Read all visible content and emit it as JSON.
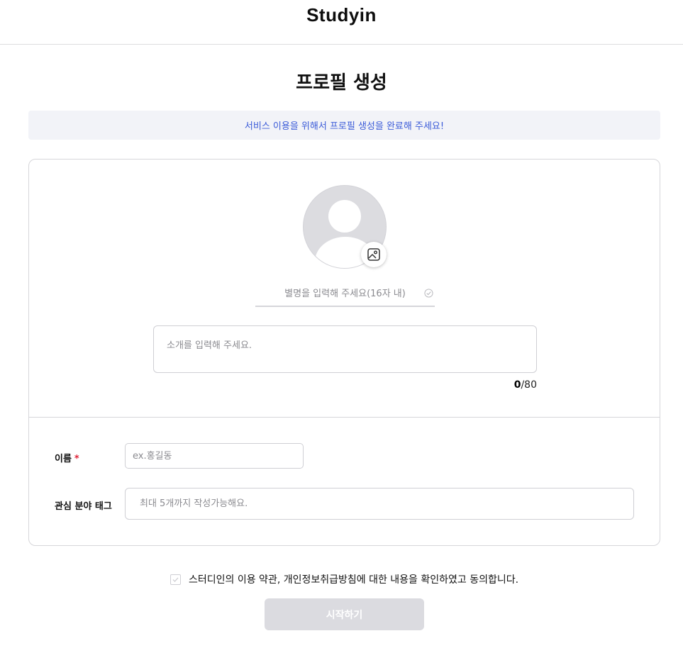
{
  "header": {
    "logo_text": "Studyin"
  },
  "page": {
    "title": "프로필 생성",
    "notice": "서비스 이용을 위해서 프로필 생성을 완료해 주세요!"
  },
  "profile": {
    "avatar_icon": "user-silhouette-icon",
    "photo_button_icon": "image-icon",
    "nickname_placeholder": "별명을 입력해 주세요(16자 내)",
    "nickname_value": "",
    "nickname_check_icon": "check-circle-icon",
    "intro_placeholder": "소개를 입력해 주세요.",
    "intro_value": "",
    "intro_count": "0",
    "intro_max": "/80"
  },
  "fields": {
    "name_label": "이름",
    "required_mark": "*",
    "name_placeholder": "ex.홍길동",
    "name_value": "",
    "tags_label": "관심 분야 태그",
    "tags_placeholder": "최대 5개까지 작성가능해요.",
    "tags_value": ""
  },
  "agreement": {
    "checked": false,
    "text": "스터디인의 이용 약관, 개인정보취급방침에 대한 내용을 확인하였고 동의합니다."
  },
  "actions": {
    "start_label": "시작하기",
    "enabled": false
  },
  "colors": {
    "accent_text": "#3b5bd8",
    "notice_bg": "#f2f3f8",
    "required": "#e0253a",
    "disabled_button": "#dbdbe0"
  }
}
